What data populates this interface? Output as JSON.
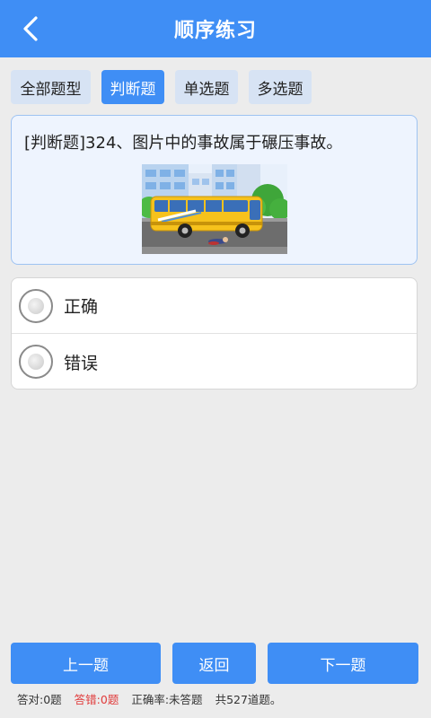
{
  "header": {
    "title": "顺序练习",
    "back_icon": "chevron-left-icon"
  },
  "tabs": [
    {
      "label": "全部题型",
      "active": false
    },
    {
      "label": "判断题",
      "active": true
    },
    {
      "label": "单选题",
      "active": false
    },
    {
      "label": "多选题",
      "active": false
    }
  ],
  "question": {
    "text": "[判断题]324、图片中的事故属于碾压事故。",
    "image": "bus-accident-illustration"
  },
  "options": [
    {
      "label": "正确",
      "selected": false
    },
    {
      "label": "错误",
      "selected": false
    }
  ],
  "buttons": {
    "prev": "上一题",
    "back": "返回",
    "next": "下一题"
  },
  "status": {
    "correct": "答对:0题",
    "wrong": "答错:0题",
    "rate": "正确率:未答题",
    "total": "共527道题。"
  },
  "colors": {
    "accent": "#3f8ef5",
    "tab_inactive": "#d7e3f4",
    "wrong_text": "#e03a3a"
  }
}
